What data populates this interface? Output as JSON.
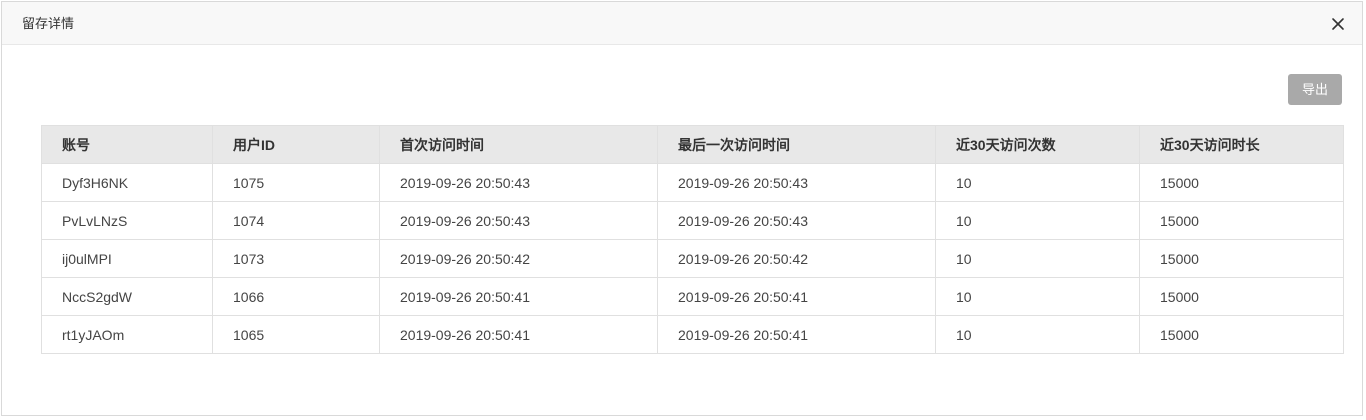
{
  "dialog": {
    "title": "留存详情",
    "close_icon": "close-icon",
    "export_label": "导出"
  },
  "table": {
    "columns": [
      "账号",
      "用户ID",
      "首次访问时间",
      "最后一次访问时间",
      "近30天访问次数",
      "近30天访问时长"
    ],
    "rows": [
      [
        "Dyf3H6NK",
        "1075",
        "2019-09-26 20:50:43",
        "2019-09-26 20:50:43",
        "10",
        "15000"
      ],
      [
        "PvLvLNzS",
        "1074",
        "2019-09-26 20:50:43",
        "2019-09-26 20:50:43",
        "10",
        "15000"
      ],
      [
        "ij0ulMPI",
        "1073",
        "2019-09-26 20:50:42",
        "2019-09-26 20:50:42",
        "10",
        "15000"
      ],
      [
        "NccS2gdW",
        "1066",
        "2019-09-26 20:50:41",
        "2019-09-26 20:50:41",
        "10",
        "15000"
      ],
      [
        "rt1yJAOm",
        "1065",
        "2019-09-26 20:50:41",
        "2019-09-26 20:50:41",
        "10",
        "15000"
      ]
    ]
  }
}
